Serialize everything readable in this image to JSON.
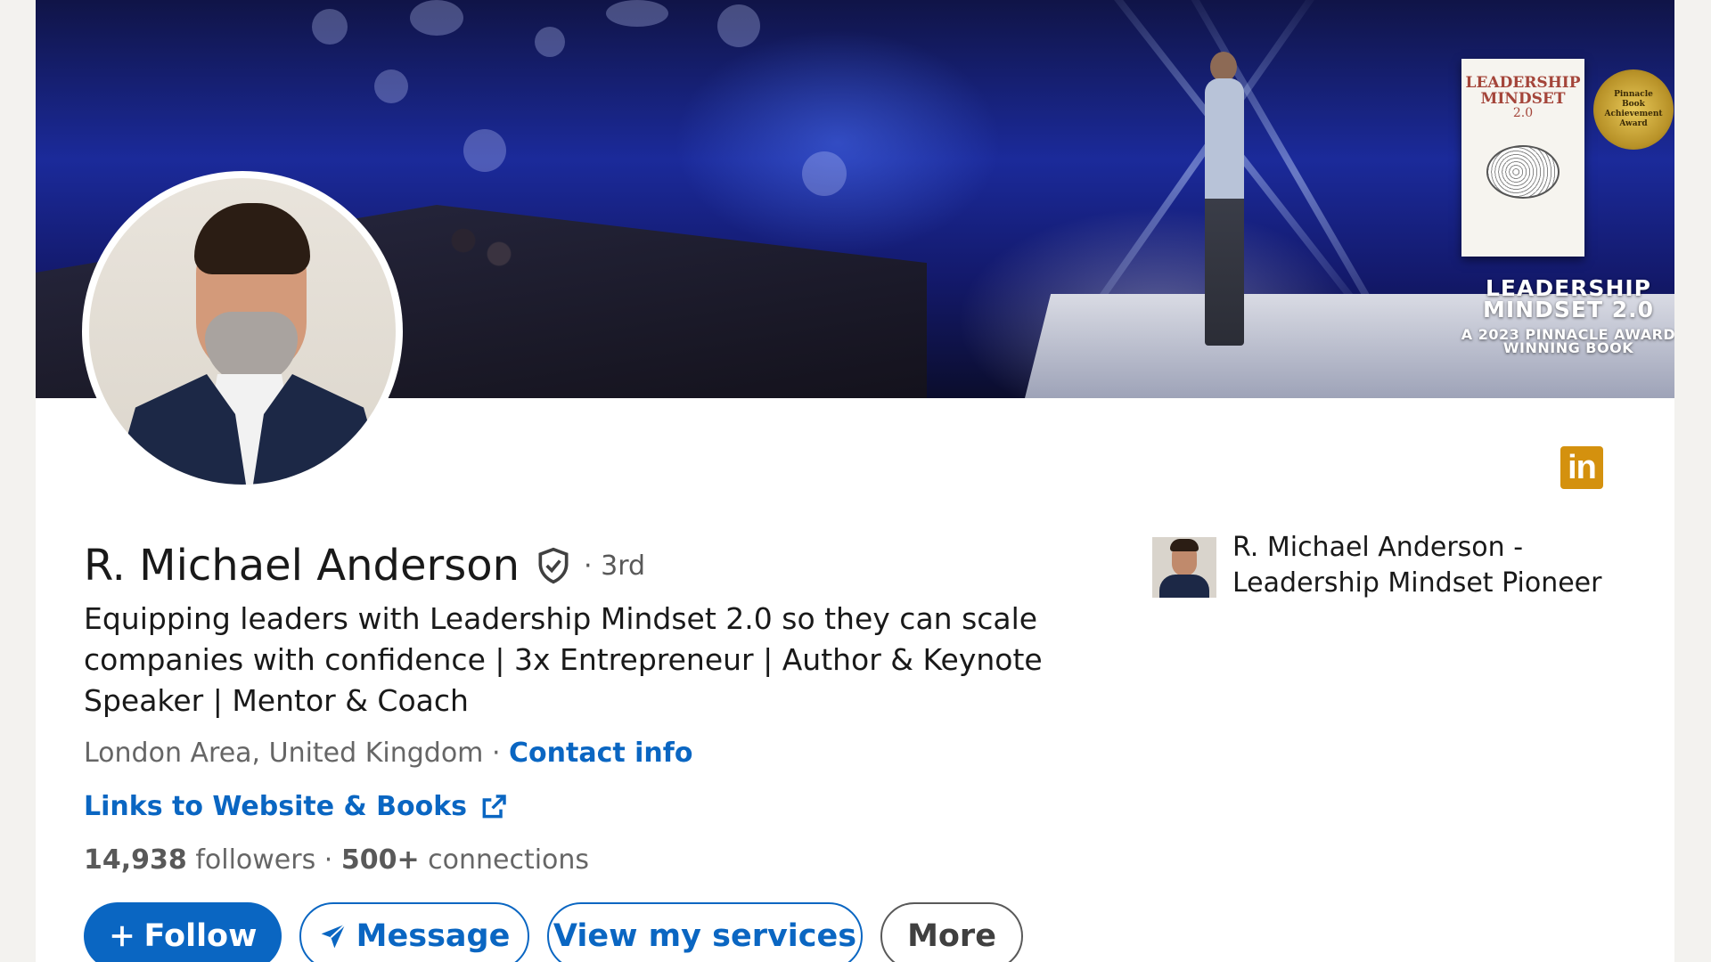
{
  "banner": {
    "book": {
      "title_line1": "LEADERSHIP",
      "title_line2": "MINDSET",
      "version": "2.0"
    },
    "award_seal": "Pinnacle Book Achievement Award",
    "caption_line1": "LEADERSHIP",
    "caption_line2": "MINDSET 2.0",
    "caption_line3": "A 2023 PINNACLE AWARD",
    "caption_line4": "WINNING BOOK"
  },
  "profile": {
    "name": "R. Michael Anderson",
    "degree": "· 3rd",
    "headline": "Equipping leaders with Leadership Mindset 2.0 so they can scale companies with confidence | 3x Entrepreneur | Author & Keynote Speaker | Mentor & Coach",
    "location": "London Area, United Kingdom",
    "location_separator": " · ",
    "contact_label": "Contact info",
    "website_label": "Links to Website & Books",
    "followers_count": "14,938",
    "followers_label": " followers",
    "stats_separator": " · ",
    "connections_count": "500+",
    "connections_label": " connections"
  },
  "actions": {
    "follow_label": "Follow",
    "message_label": "Message",
    "services_label": "View my services",
    "more_label": "More"
  },
  "company": {
    "name": "R. Michael Anderson - Leadership Mindset Pioneer"
  },
  "brand": {
    "logo_text": "in",
    "linkedin_blue": "#0a66c2",
    "badge_color": "#d4910e"
  },
  "icons": {
    "verified": "shield-check-icon",
    "external": "external-link-icon",
    "follow": "plus-icon",
    "message": "paper-plane-icon"
  }
}
